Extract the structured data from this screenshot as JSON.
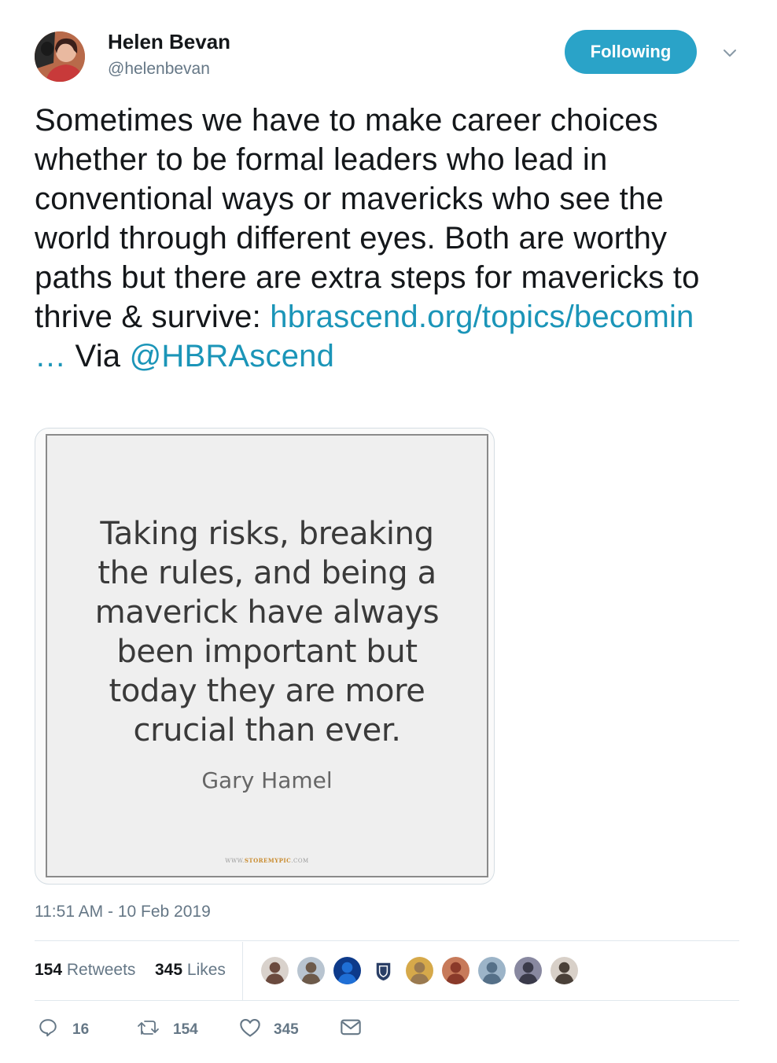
{
  "author": {
    "name": "Helen Bevan",
    "handle": "@helenbevan",
    "follow_label": "Following"
  },
  "tweet": {
    "text_main": "Sometimes we have to make career choices whether to be formal leaders who lead in conventional ways or mavericks who see the world through different eyes. Both are worthy paths but there are extra steps for mavericks to thrive & survive:",
    "link_text": "hbrascend.org/topics/becomin",
    "ellipsis": "…",
    "via_text": "Via",
    "mention": "@HBRAscend"
  },
  "media": {
    "quote_lines": [
      "Taking risks, breaking",
      "the rules, and being a",
      "maverick have always",
      "been important but",
      "today they are more",
      "crucial than ever."
    ],
    "quote_author": "Gary Hamel",
    "watermark_prefix": "WWW.",
    "watermark_brand": "STOREMYPIC",
    "watermark_suffix": ".COM"
  },
  "timestamp": "11:51 AM - 10 Feb 2019",
  "stats": {
    "retweets_count": "154",
    "retweets_label": "Retweets",
    "likes_count": "345",
    "likes_label": "Likes"
  },
  "likers": [
    {
      "icon": "user-avatar-icon",
      "color": "#6b4a3e",
      "bg": "#d9d2cc"
    },
    {
      "icon": "user-avatar-icon",
      "color": "#6d5a4a",
      "bg": "#b8c4d0"
    },
    {
      "icon": "user-avatar-icon",
      "color": "#1f6fd6",
      "bg": "#0d3a8a"
    },
    {
      "icon": "shield-logo-icon",
      "color": "#2a3f66",
      "bg": "#ffffff"
    },
    {
      "icon": "user-avatar-icon",
      "color": "#9a7a50",
      "bg": "#d6a94a"
    },
    {
      "icon": "user-avatar-icon",
      "color": "#8a3a2a",
      "bg": "#c77a5a"
    },
    {
      "icon": "user-avatar-icon",
      "color": "#557088",
      "bg": "#9cb4c8"
    },
    {
      "icon": "user-avatar-icon",
      "color": "#3a3a4a",
      "bg": "#8888a0"
    },
    {
      "icon": "user-avatar-icon",
      "color": "#4a4038",
      "bg": "#d8d0c8"
    }
  ],
  "actions": {
    "reply_count": "16",
    "retweet_count": "154",
    "like_count": "345"
  },
  "colors": {
    "accent": "#2aa3c8",
    "link": "#1b95b8",
    "muted": "#657786",
    "text": "#14171a"
  }
}
